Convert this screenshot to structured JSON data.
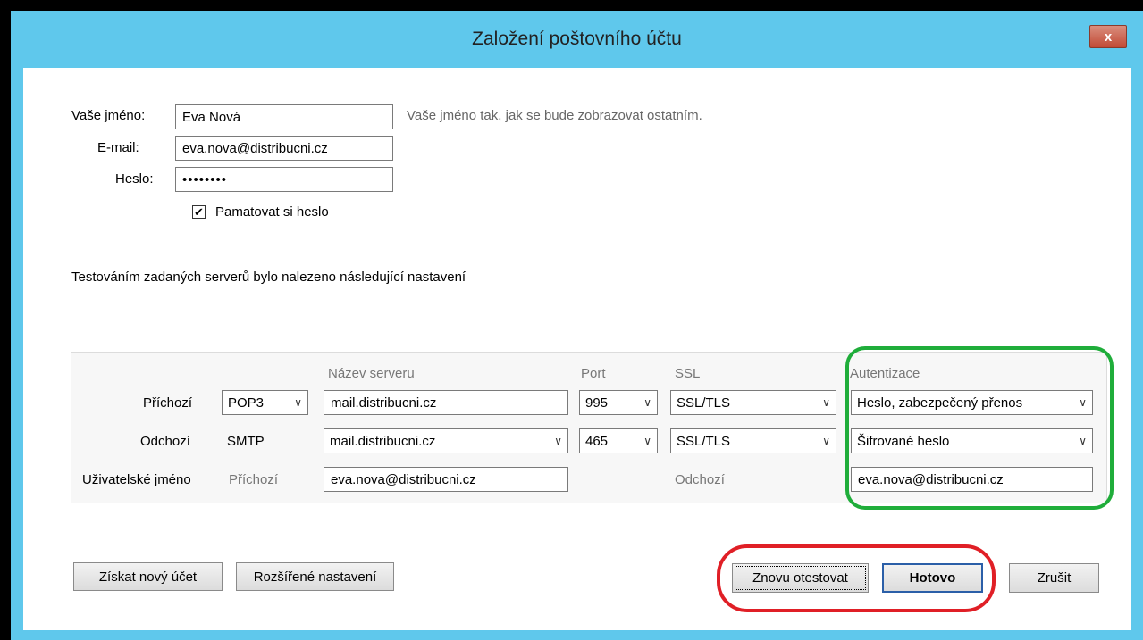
{
  "window": {
    "title": "Založení poštovního účtu",
    "close_label": "x"
  },
  "form": {
    "name_label": "Vaše jméno:",
    "name_value": "Eva Nová",
    "name_hint": "Vaše jméno tak, jak se bude zobrazovat ostatním.",
    "email_label": "E-mail:",
    "email_value": "eva.nova@distribucni.cz",
    "password_label": "Heslo:",
    "password_value": "••••••••",
    "remember_label": "Pamatovat si heslo",
    "remember_checked": true,
    "remember_check_glyph": "✔"
  },
  "status_text": "Testováním zadaných serverů bylo nalezeno následující nastavení",
  "servers": {
    "col_server": "Název serveru",
    "col_port": "Port",
    "col_ssl": "SSL",
    "col_auth": "Autentizace",
    "incoming": {
      "label": "Příchozí",
      "protocol": "POP3",
      "server": "mail.distribucni.cz",
      "port": "995",
      "ssl": "SSL/TLS",
      "auth": "Heslo, zabezpečený přenos"
    },
    "outgoing": {
      "label": "Odchozí",
      "protocol": "SMTP",
      "server": "mail.distribucni.cz",
      "port": "465",
      "ssl": "SSL/TLS",
      "auth": "Šifrované heslo"
    },
    "username": {
      "label": "Uživatelské jméno",
      "incoming_label": "Příchozí",
      "incoming_value": "eva.nova@distribucni.cz",
      "outgoing_label": "Odchozí",
      "outgoing_value": "eva.nova@distribucni.cz"
    }
  },
  "buttons": {
    "new_account": "Získat nový účet",
    "advanced": "Rozšířené nastavení",
    "retest": "Znovu otestovat",
    "done": "Hotovo",
    "cancel": "Zrušit"
  },
  "colors": {
    "titlebar": "#5fc8ec",
    "highlight_green": "#1fad3a",
    "highlight_red": "#e01f26"
  }
}
